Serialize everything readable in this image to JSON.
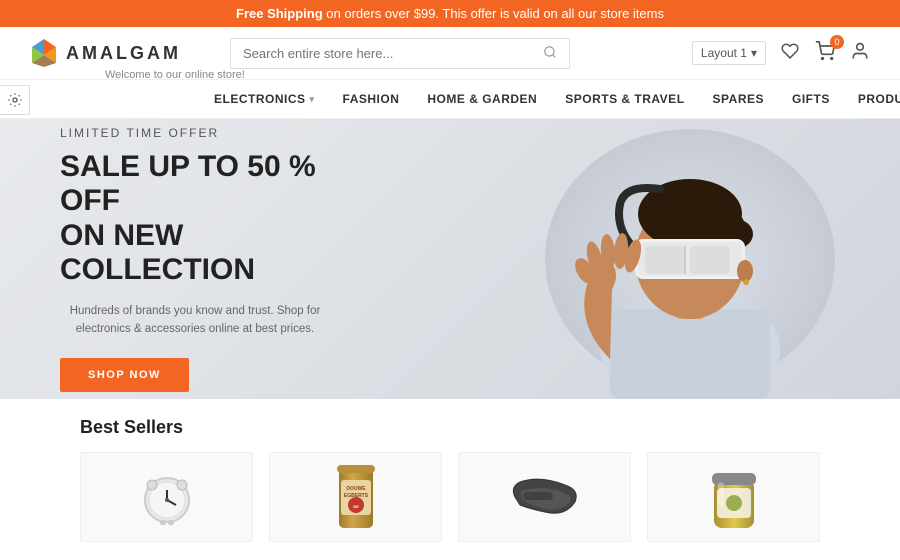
{
  "banner": {
    "bold_text": "Free Shipping",
    "rest_text": " on orders over $99. This offer is valid on all our store items"
  },
  "header": {
    "welcome": "Welcome to our online store!",
    "logo_text": "AMALGAM",
    "search_placeholder": "Search entire store here...",
    "layout_btn": "Layout 1",
    "cart_count": "0"
  },
  "nav": {
    "items": [
      {
        "label": "ELECTRONICS",
        "has_caret": true
      },
      {
        "label": "FASHION",
        "has_caret": false
      },
      {
        "label": "HOME & GARDEN",
        "has_caret": false
      },
      {
        "label": "SPORTS & TRAVEL",
        "has_caret": false
      },
      {
        "label": "SPARES",
        "has_caret": false
      },
      {
        "label": "GIFTS",
        "has_caret": false
      },
      {
        "label": "PRODUCT TYPES",
        "has_caret": true
      }
    ]
  },
  "hero": {
    "subtitle": "LIMITED TIME OFFER",
    "title": "SALE UP TO 50 % OFF\nON NEW COLLECTION",
    "description": "Hundreds of brands you know and trust. Shop for electronics & accessories online at best prices.",
    "cta_label": "SHOP NOW"
  },
  "best_sellers": {
    "title": "Best Sellers",
    "products": [
      {
        "icon": "⏰",
        "name": "clock"
      },
      {
        "icon": "☕",
        "name": "coffee"
      },
      {
        "icon": "🥿",
        "name": "shoes"
      },
      {
        "icon": "🫙",
        "name": "jar"
      }
    ]
  }
}
